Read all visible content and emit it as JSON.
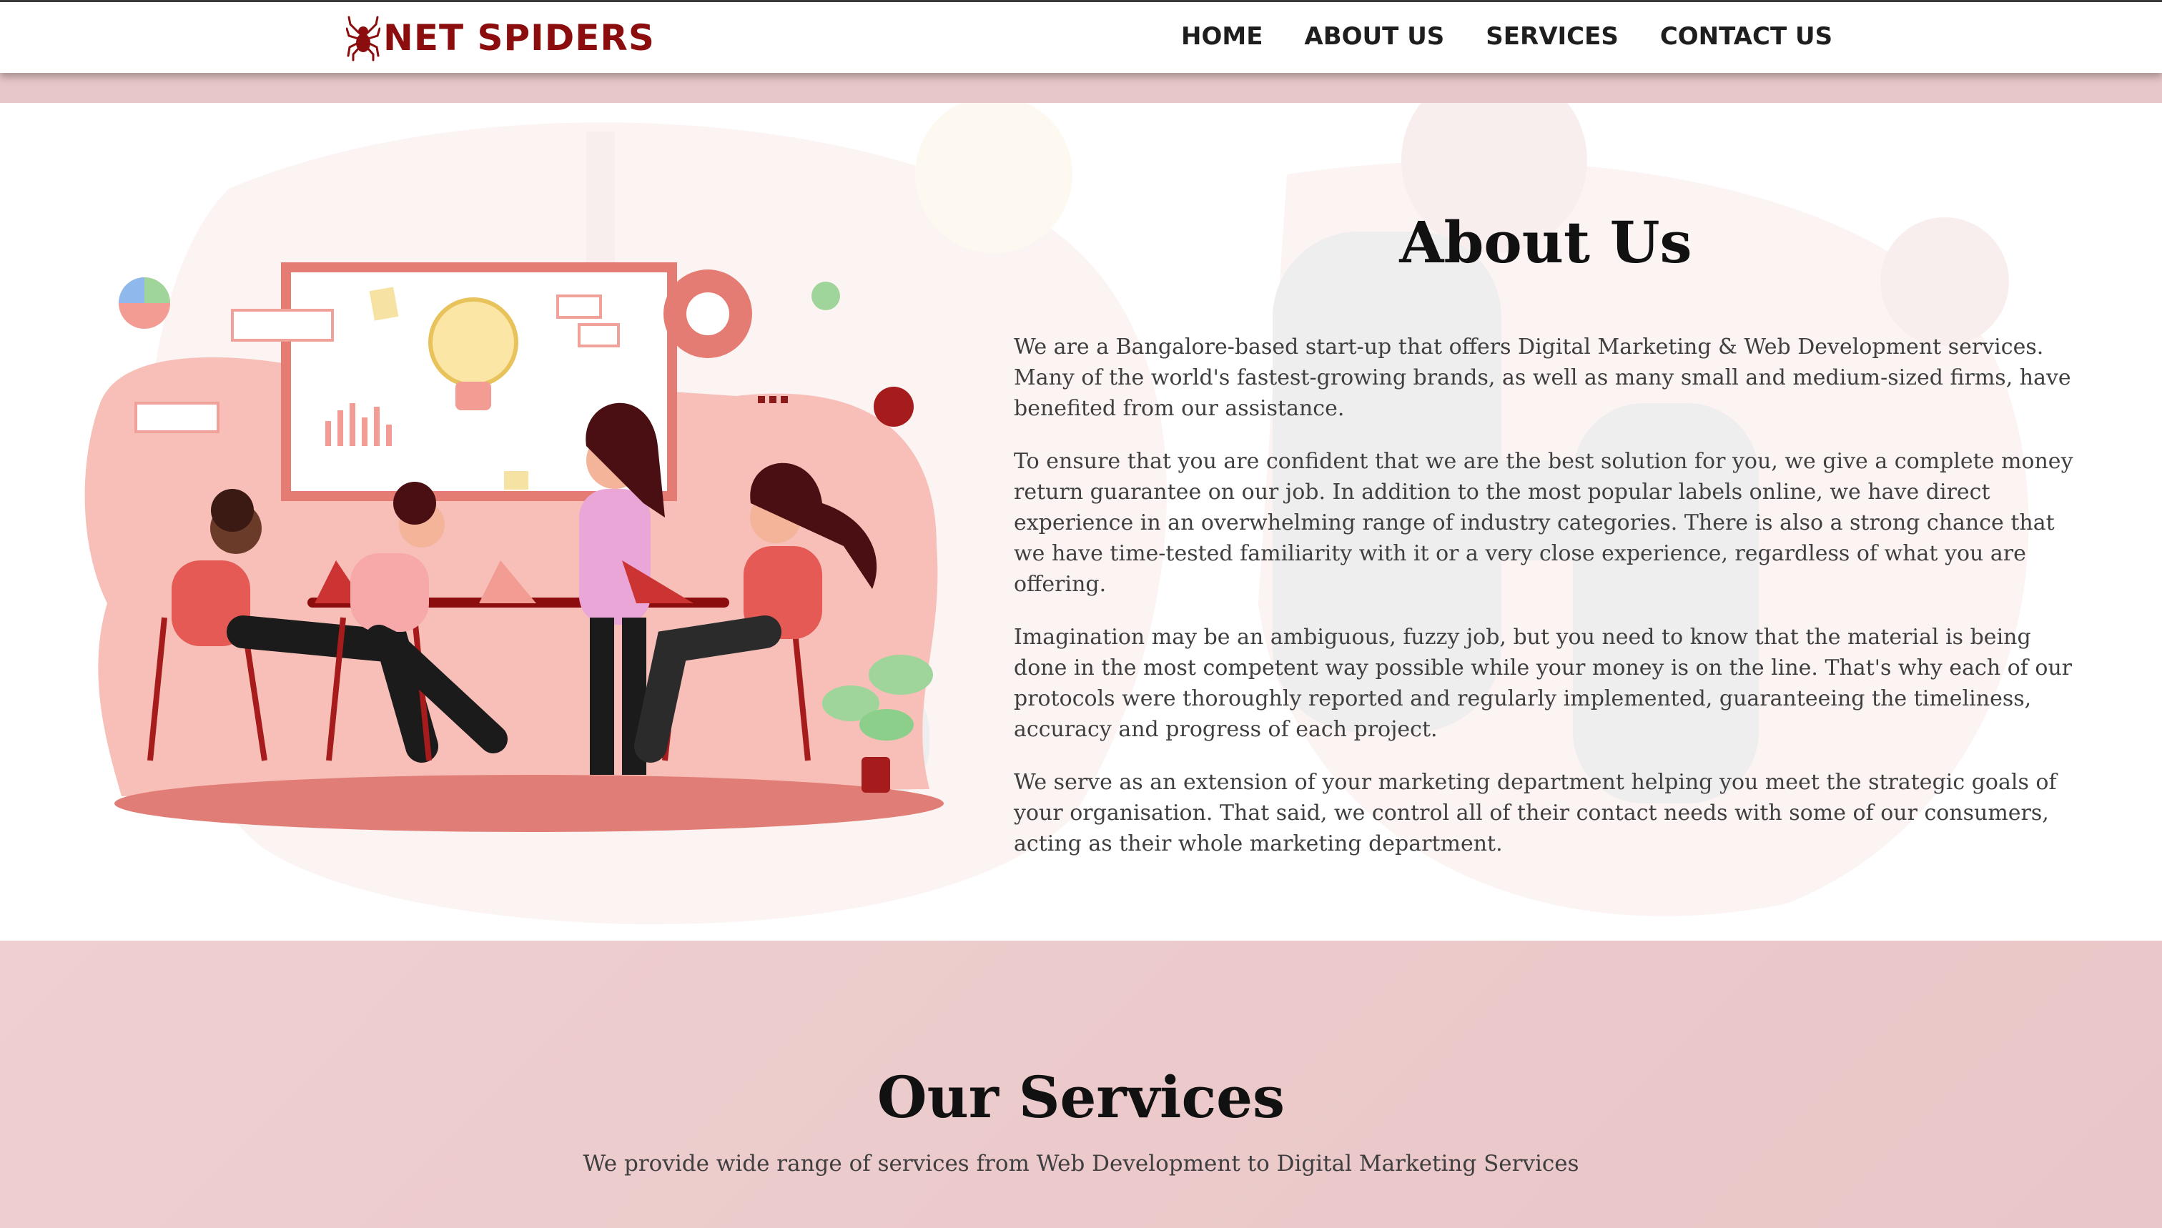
{
  "header": {
    "brand": "NET SPIDERS",
    "nav": [
      "HOME",
      "ABOUT US",
      "SERVICES",
      "CONTACT US"
    ]
  },
  "about": {
    "title": "About Us",
    "paragraphs": [
      "We are a Bangalore-based start-up that offers Digital Marketing & Web Development services. Many of the world's fastest-growing brands, as well as many small and medium-sized firms, have benefited from our assistance.",
      "To ensure that you are confident that we are the best solution for you, we give a complete money return guarantee on our job. In addition to the most popular labels online, we have direct experience in an overwhelming range of industry categories. There is also a strong chance that we have time-tested familiarity with it or a very close experience, regardless of what you are offering.",
      "Imagination may be an ambiguous, fuzzy job, but you need to know that the material is being done in the most competent way possible while your money is on the line. That's why each of our protocols were thoroughly reported and regularly implemented, guaranteeing the timeliness, accuracy and progress of each project.",
      "We serve as an extension of your marketing department helping you meet the strategic goals of your organisation. That said, we control all of their contact needs with some of our consumers, acting as their whole marketing department."
    ]
  },
  "services": {
    "title": "Our Services",
    "subtitle": "We provide wide range of services from Web Development to Digital Marketing Services"
  },
  "icons": {
    "logo": "spider-icon"
  },
  "colors": {
    "brand": "#8b0d0d",
    "accent_pink": "#f4b6ae",
    "services_bg": "#ecc9ca"
  }
}
